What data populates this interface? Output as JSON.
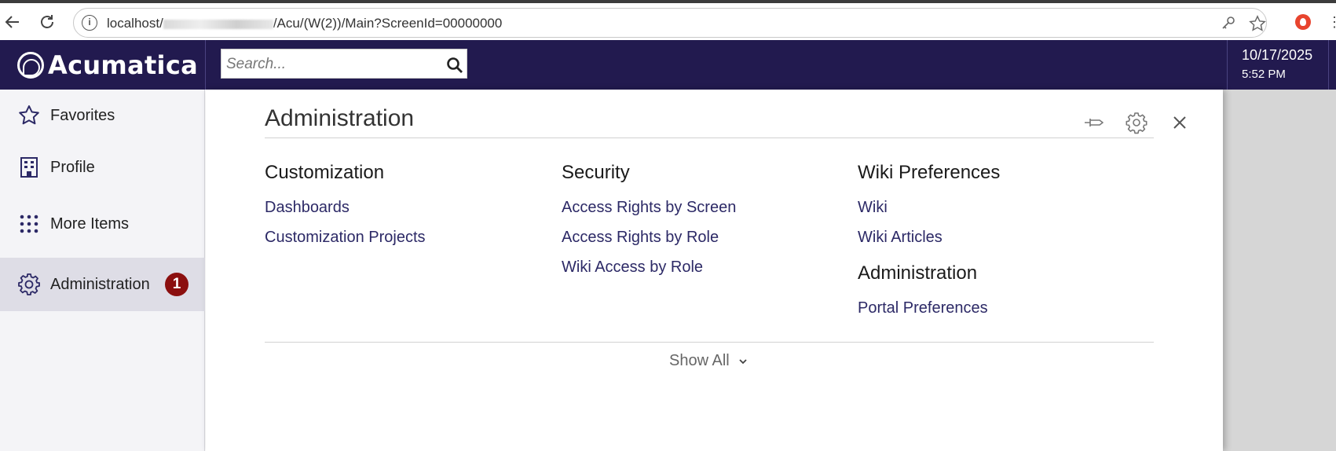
{
  "browser": {
    "url_prefix": "localhost/",
    "url_suffix": "/Acu/(W(2))/Main?ScreenId=00000000"
  },
  "header": {
    "logo_text": "Acumatica",
    "search_placeholder": "Search...",
    "date": "10/17/2025",
    "time": "5:52 PM"
  },
  "sidebar": {
    "items": [
      {
        "label": "Favorites",
        "icon": "star-icon"
      },
      {
        "label": "Profile",
        "icon": "building-icon"
      },
      {
        "label": "More Items",
        "icon": "grid-dots-icon"
      },
      {
        "label": "Administration",
        "icon": "gear-icon",
        "active": true,
        "badge": "1"
      }
    ]
  },
  "panel": {
    "title": "Administration",
    "columns": [
      {
        "groups": [
          {
            "heading": "Customization",
            "links": [
              "Dashboards",
              "Customization Projects"
            ]
          }
        ]
      },
      {
        "groups": [
          {
            "heading": "Security",
            "links": [
              "Access Rights by Screen",
              "Access Rights by Role",
              "Wiki Access by Role"
            ]
          }
        ]
      },
      {
        "groups": [
          {
            "heading": "Wiki Preferences",
            "links": [
              "Wiki",
              "Wiki Articles"
            ]
          },
          {
            "heading": "Administration",
            "links": [
              "Portal Preferences"
            ]
          }
        ]
      }
    ],
    "show_all_label": "Show All"
  },
  "colors": {
    "header_bg": "#221a4f",
    "link": "#2c2966",
    "badge": "#8b0f0f",
    "sidebar_bg": "#f4f4f7",
    "sidebar_active": "#dedde6"
  }
}
